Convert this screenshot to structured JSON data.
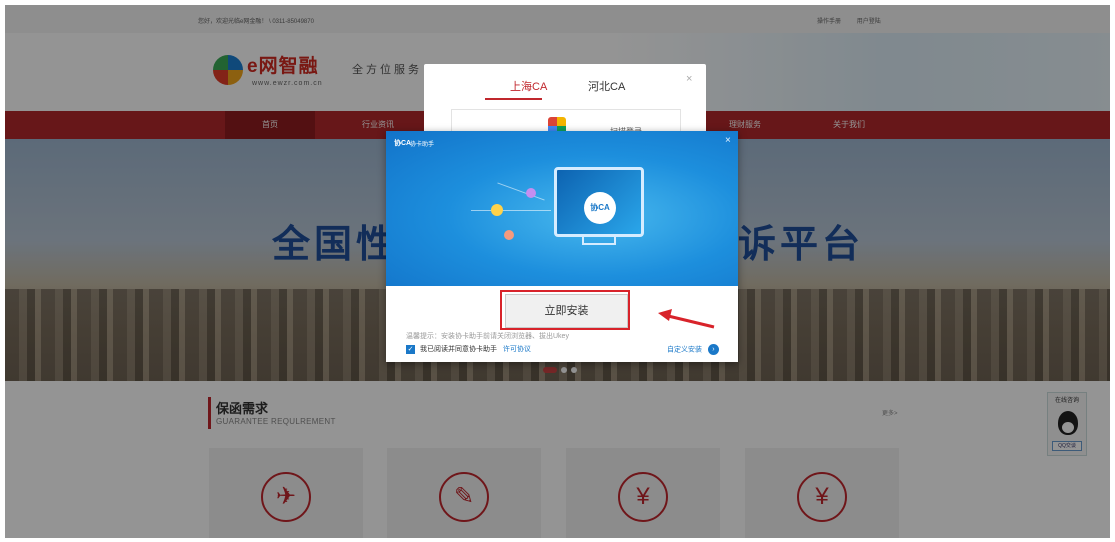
{
  "topbar": {
    "welcome": "您好，欢迎光临e网金融！ \\ 0311-85049870",
    "links": [
      "操作手册",
      "用户登陆"
    ]
  },
  "header": {
    "logo_text": "e网智融",
    "logo_url": "www.ewzr.com.cn",
    "slogan": "全方位服务"
  },
  "nav": {
    "items": [
      "首页",
      "行业资讯",
      "",
      "",
      "理财服务",
      "关于我们"
    ]
  },
  "banner": {
    "title_left": "全国性",
    "title_right": "诉平台"
  },
  "section": {
    "title": "保函需求",
    "subtitle": "GUARANTEE REQULREMENT",
    "more": "更多>"
  },
  "qq_widget": {
    "label": "在线咨询",
    "button": "QQ交谈"
  },
  "ca_dialog": {
    "tabs": [
      "上海CA",
      "河北CA"
    ],
    "active_tab": 0,
    "close": "×",
    "scan_text": "扫描登录"
  },
  "installer": {
    "title": "协卡助手",
    "brand_small": "协CA",
    "close": "×",
    "monitor_logo": "协CA",
    "install_button": "立即安装",
    "tip": "温馨提示：安装协卡助手前请关闭浏览器、拔出Ukey",
    "agree_checked": true,
    "agree_text": "我已阅读并同意协卡助手",
    "license_link": "许可协议",
    "custom_install": "自定义安装",
    "colors": {
      "accent": "#1a78c8",
      "highlight": "#d8232a"
    }
  },
  "colors": {
    "brand_red": "#b1282b",
    "overlay": "rgba(0,0,0,0.42)"
  }
}
